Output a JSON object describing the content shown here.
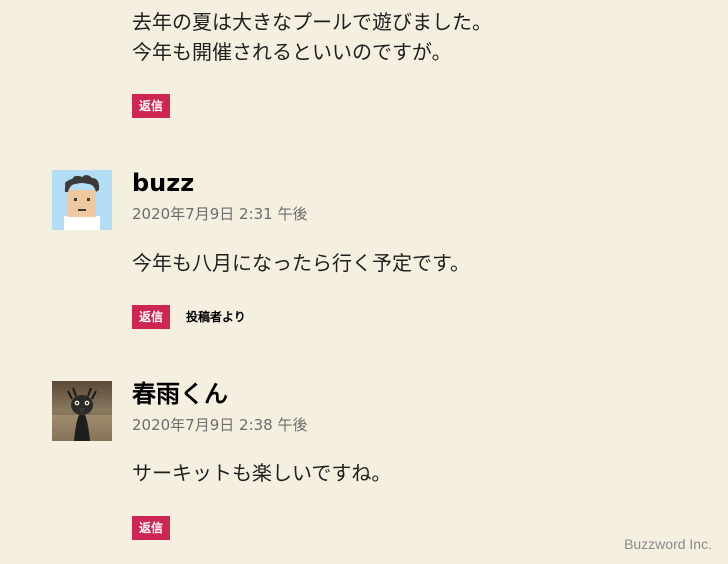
{
  "comments": [
    {
      "text_lines": [
        "去年の夏は大きなプールで遊びました。",
        "今年も開催されるといいのですが。"
      ],
      "reply_label": "返信"
    },
    {
      "author": "buzz",
      "date": "2020年7月9日 2:31 午後",
      "text": "今年も八月になったら行く予定です。",
      "reply_label": "返信",
      "badge": "投稿者より",
      "avatar_icon": "cartoon-person-avatar"
    },
    {
      "author": "春雨くん",
      "date": "2020年7月9日 2:38 午後",
      "text": "サーキットも楽しいですね。",
      "reply_label": "返信",
      "avatar_icon": "emu-photo-avatar"
    }
  ],
  "watermark": "Buzzword Inc.",
  "colors": {
    "background": "#f5efe0",
    "accent": "#cd2653",
    "meta_text": "#6d6d6d"
  }
}
